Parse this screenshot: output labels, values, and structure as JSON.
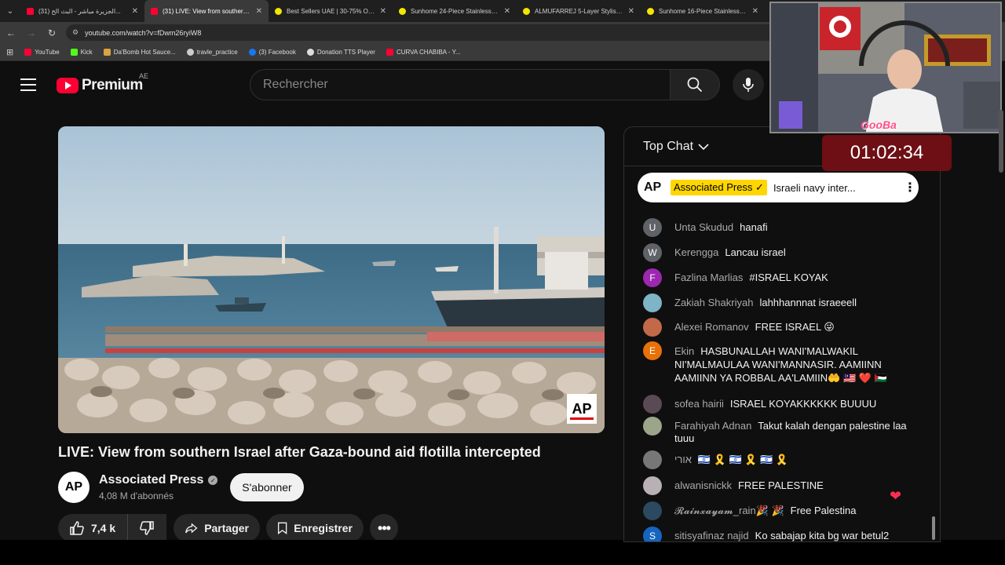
{
  "browser": {
    "tabs": [
      {
        "label": "(31) الجزيرة مباشر - البث الح...",
        "favicon": "youtube-icon",
        "active": false
      },
      {
        "label": "(31) LIVE: View from southern Is...",
        "favicon": "youtube-icon",
        "active": true
      },
      {
        "label": "Best Sellers UAE | 30-75% OFF |...",
        "favicon": "noon-icon",
        "active": false
      },
      {
        "label": "Sunhome 24-Piece Stainless Ste...",
        "favicon": "noon-icon",
        "active": false
      },
      {
        "label": "ALMUFARREJ 5-Layer Stylish Sh...",
        "favicon": "noon-icon",
        "active": false
      },
      {
        "label": "Sunhome 16-Piece Stainless Ste...",
        "favicon": "noon-icon",
        "active": false
      }
    ],
    "url": "youtube.com/watch?v=fDwm26ryiW8",
    "bookmarks": [
      {
        "label": "YouTube",
        "color": "#ff0033"
      },
      {
        "label": "Kick",
        "color": "#53fc18"
      },
      {
        "label": "Da'Bomb Hot Sauce...",
        "color": "#d9a441"
      },
      {
        "label": "travle_practice",
        "color": "#cccccc"
      },
      {
        "label": "(3) Facebook",
        "color": "#1877f2"
      },
      {
        "label": "Donation TTS Player",
        "color": "#dddddd"
      },
      {
        "label": "CURVA CHABIBA - Y...",
        "color": "#ff0033"
      }
    ]
  },
  "header": {
    "brand": "Premium",
    "region": "AE",
    "search_placeholder": "Rechercher"
  },
  "video": {
    "title": "LIVE: View from southern Israel after Gaza-bound aid flotilla intercepted",
    "watermark": "AP"
  },
  "channel": {
    "avatar_text": "AP",
    "name": "Associated Press",
    "subscribers": "4,08 M d'abonnés",
    "subscribe_label": "S'abonner"
  },
  "actions": {
    "likes": "7,4 k",
    "share_label": "Partager",
    "save_label": "Enregistrer"
  },
  "chat": {
    "header": "Top Chat",
    "pinned": {
      "logo": "AP",
      "author": "Associated Press ✓",
      "message": "Israeli navy inter..."
    },
    "messages": [
      {
        "author": "Unta Skudud",
        "text": "hanafi",
        "avatar": "U",
        "color": "#5f6368"
      },
      {
        "author": "Kerengga",
        "text": "Lancau israel",
        "avatar": "W",
        "color": "#5f6368"
      },
      {
        "author": "Fazlina Marlias",
        "text": "#ISRAEL KOYAK",
        "avatar": "F",
        "color": "#9c27b0"
      },
      {
        "author": "Zakiah Shakriyah",
        "text": "lahhhannnat israeeell",
        "avatar": "",
        "color": "#7fb3c6"
      },
      {
        "author": "Alexei Romanov",
        "text": "FREE ISRAEL 😜",
        "avatar": "",
        "color": "#c2694a"
      },
      {
        "author": "Ekin",
        "text": "HASBUNALLAH WANI'MALWAKIL NI'MALMAULAA WANI'MANNASIR. AAMIINN AAMIINN YA ROBBAL AA'LAMIIN🤲 🇲🇾 ❤️ 🇵🇸",
        "avatar": "E",
        "color": "#e8710a"
      },
      {
        "author": "sofea hairii",
        "text": "ISRAEL KOYAKKKKKK BUUUU",
        "avatar": "",
        "color": "#5a4a55"
      },
      {
        "author": "Farahiyah Adnan",
        "text": "Takut kalah dengan palestine laa tuuu",
        "avatar": "",
        "color": "#9aa58a"
      },
      {
        "author": "אורי",
        "text": "🇮🇱 🎗️ 🇮🇱 🎗️ 🇮🇱 🎗️",
        "avatar": "",
        "color": "#777777"
      },
      {
        "author": "alwanisnickk",
        "text": "FREE PALESTINE",
        "avatar": "",
        "color": "#b8b0b5"
      },
      {
        "author": "𝓡𝓪𝓲𝓷𝔁𝓪𝔂𝓪𝓶_rain🎉 🎉",
        "text": "Free Palestina",
        "avatar": "",
        "color": "#2b4a5f"
      },
      {
        "author": "sitisyafinaz najid",
        "text": "Ko sabajap kita bg war betul2",
        "avatar": "S",
        "color": "#1565c0"
      }
    ]
  },
  "overlay": {
    "streamer_label": "GooBa",
    "timer": "01:02:34"
  }
}
